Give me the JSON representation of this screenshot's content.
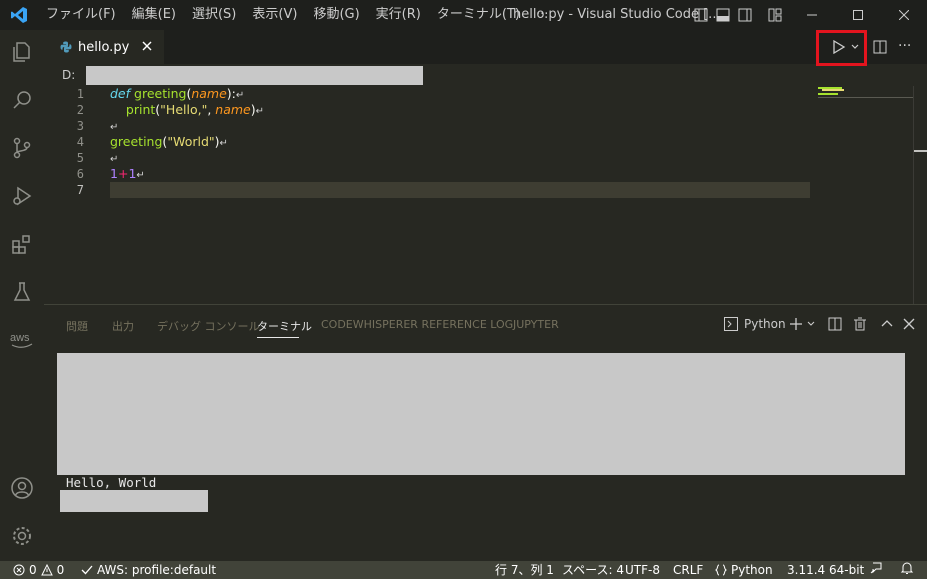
{
  "window": {
    "title": "hello.py - Visual Studio Code [...",
    "menu": [
      "ファイル(F)",
      "編集(E)",
      "選択(S)",
      "表示(V)",
      "移動(G)",
      "実行(R)",
      "ターミナル(T)",
      "···"
    ]
  },
  "tab": {
    "label": "hello.py"
  },
  "breadcrumb": {
    "drive": "D:"
  },
  "editor": {
    "line_numbers": [
      "1",
      "2",
      "3",
      "4",
      "5",
      "6",
      "7"
    ],
    "lines": {
      "l1_kw": "def",
      "l1_fn": "greeting",
      "l1_p_open": "(",
      "l1_param": "name",
      "l1_p_close": "):",
      "l2_fn": "print",
      "l2_open": "(",
      "l2_str": "\"Hello,\"",
      "l2_comma": ", ",
      "l2_param": "name",
      "l2_close": ")",
      "l4_fn": "greeting",
      "l4_open": "(",
      "l4_str": "\"World\"",
      "l4_close": ")",
      "l6_n1": "1",
      "l6_op": "+",
      "l6_n2": "1"
    },
    "eol_mark": "↵"
  },
  "panel": {
    "tabs": [
      "問題",
      "出力",
      "デバッグ コンソール",
      "ターミナル",
      "CODEWHISPERER REFERENCE LOG",
      "JUPYTER"
    ],
    "active_tab": "ターミナル",
    "terminal_name": "Python",
    "output": "Hello, World"
  },
  "statusbar": {
    "errors": "0",
    "warnings": "0",
    "aws": "AWS: profile:default",
    "position": "行 7、列 1",
    "spaces": "スペース: 4",
    "encoding": "UTF-8",
    "eol": "CRLF",
    "language": "Python",
    "interpreter": "3.11.4 64-bit"
  }
}
